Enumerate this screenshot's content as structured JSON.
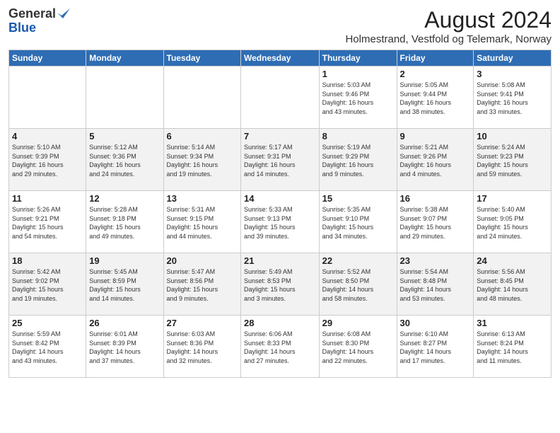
{
  "logo": {
    "general": "General",
    "blue": "Blue"
  },
  "title": "August 2024",
  "subtitle": "Holmestrand, Vestfold og Telemark, Norway",
  "headers": [
    "Sunday",
    "Monday",
    "Tuesday",
    "Wednesday",
    "Thursday",
    "Friday",
    "Saturday"
  ],
  "weeks": [
    [
      {
        "day": "",
        "info": ""
      },
      {
        "day": "",
        "info": ""
      },
      {
        "day": "",
        "info": ""
      },
      {
        "day": "",
        "info": ""
      },
      {
        "day": "1",
        "info": "Sunrise: 5:03 AM\nSunset: 9:46 PM\nDaylight: 16 hours\nand 43 minutes."
      },
      {
        "day": "2",
        "info": "Sunrise: 5:05 AM\nSunset: 9:44 PM\nDaylight: 16 hours\nand 38 minutes."
      },
      {
        "day": "3",
        "info": "Sunrise: 5:08 AM\nSunset: 9:41 PM\nDaylight: 16 hours\nand 33 minutes."
      }
    ],
    [
      {
        "day": "4",
        "info": "Sunrise: 5:10 AM\nSunset: 9:39 PM\nDaylight: 16 hours\nand 29 minutes."
      },
      {
        "day": "5",
        "info": "Sunrise: 5:12 AM\nSunset: 9:36 PM\nDaylight: 16 hours\nand 24 minutes."
      },
      {
        "day": "6",
        "info": "Sunrise: 5:14 AM\nSunset: 9:34 PM\nDaylight: 16 hours\nand 19 minutes."
      },
      {
        "day": "7",
        "info": "Sunrise: 5:17 AM\nSunset: 9:31 PM\nDaylight: 16 hours\nand 14 minutes."
      },
      {
        "day": "8",
        "info": "Sunrise: 5:19 AM\nSunset: 9:29 PM\nDaylight: 16 hours\nand 9 minutes."
      },
      {
        "day": "9",
        "info": "Sunrise: 5:21 AM\nSunset: 9:26 PM\nDaylight: 16 hours\nand 4 minutes."
      },
      {
        "day": "10",
        "info": "Sunrise: 5:24 AM\nSunset: 9:23 PM\nDaylight: 15 hours\nand 59 minutes."
      }
    ],
    [
      {
        "day": "11",
        "info": "Sunrise: 5:26 AM\nSunset: 9:21 PM\nDaylight: 15 hours\nand 54 minutes."
      },
      {
        "day": "12",
        "info": "Sunrise: 5:28 AM\nSunset: 9:18 PM\nDaylight: 15 hours\nand 49 minutes."
      },
      {
        "day": "13",
        "info": "Sunrise: 5:31 AM\nSunset: 9:15 PM\nDaylight: 15 hours\nand 44 minutes."
      },
      {
        "day": "14",
        "info": "Sunrise: 5:33 AM\nSunset: 9:13 PM\nDaylight: 15 hours\nand 39 minutes."
      },
      {
        "day": "15",
        "info": "Sunrise: 5:35 AM\nSunset: 9:10 PM\nDaylight: 15 hours\nand 34 minutes."
      },
      {
        "day": "16",
        "info": "Sunrise: 5:38 AM\nSunset: 9:07 PM\nDaylight: 15 hours\nand 29 minutes."
      },
      {
        "day": "17",
        "info": "Sunrise: 5:40 AM\nSunset: 9:05 PM\nDaylight: 15 hours\nand 24 minutes."
      }
    ],
    [
      {
        "day": "18",
        "info": "Sunrise: 5:42 AM\nSunset: 9:02 PM\nDaylight: 15 hours\nand 19 minutes."
      },
      {
        "day": "19",
        "info": "Sunrise: 5:45 AM\nSunset: 8:59 PM\nDaylight: 15 hours\nand 14 minutes."
      },
      {
        "day": "20",
        "info": "Sunrise: 5:47 AM\nSunset: 8:56 PM\nDaylight: 15 hours\nand 9 minutes."
      },
      {
        "day": "21",
        "info": "Sunrise: 5:49 AM\nSunset: 8:53 PM\nDaylight: 15 hours\nand 3 minutes."
      },
      {
        "day": "22",
        "info": "Sunrise: 5:52 AM\nSunset: 8:50 PM\nDaylight: 14 hours\nand 58 minutes."
      },
      {
        "day": "23",
        "info": "Sunrise: 5:54 AM\nSunset: 8:48 PM\nDaylight: 14 hours\nand 53 minutes."
      },
      {
        "day": "24",
        "info": "Sunrise: 5:56 AM\nSunset: 8:45 PM\nDaylight: 14 hours\nand 48 minutes."
      }
    ],
    [
      {
        "day": "25",
        "info": "Sunrise: 5:59 AM\nSunset: 8:42 PM\nDaylight: 14 hours\nand 43 minutes."
      },
      {
        "day": "26",
        "info": "Sunrise: 6:01 AM\nSunset: 8:39 PM\nDaylight: 14 hours\nand 37 minutes."
      },
      {
        "day": "27",
        "info": "Sunrise: 6:03 AM\nSunset: 8:36 PM\nDaylight: 14 hours\nand 32 minutes."
      },
      {
        "day": "28",
        "info": "Sunrise: 6:06 AM\nSunset: 8:33 PM\nDaylight: 14 hours\nand 27 minutes."
      },
      {
        "day": "29",
        "info": "Sunrise: 6:08 AM\nSunset: 8:30 PM\nDaylight: 14 hours\nand 22 minutes."
      },
      {
        "day": "30",
        "info": "Sunrise: 6:10 AM\nSunset: 8:27 PM\nDaylight: 14 hours\nand 17 minutes."
      },
      {
        "day": "31",
        "info": "Sunrise: 6:13 AM\nSunset: 8:24 PM\nDaylight: 14 hours\nand 11 minutes."
      }
    ]
  ]
}
